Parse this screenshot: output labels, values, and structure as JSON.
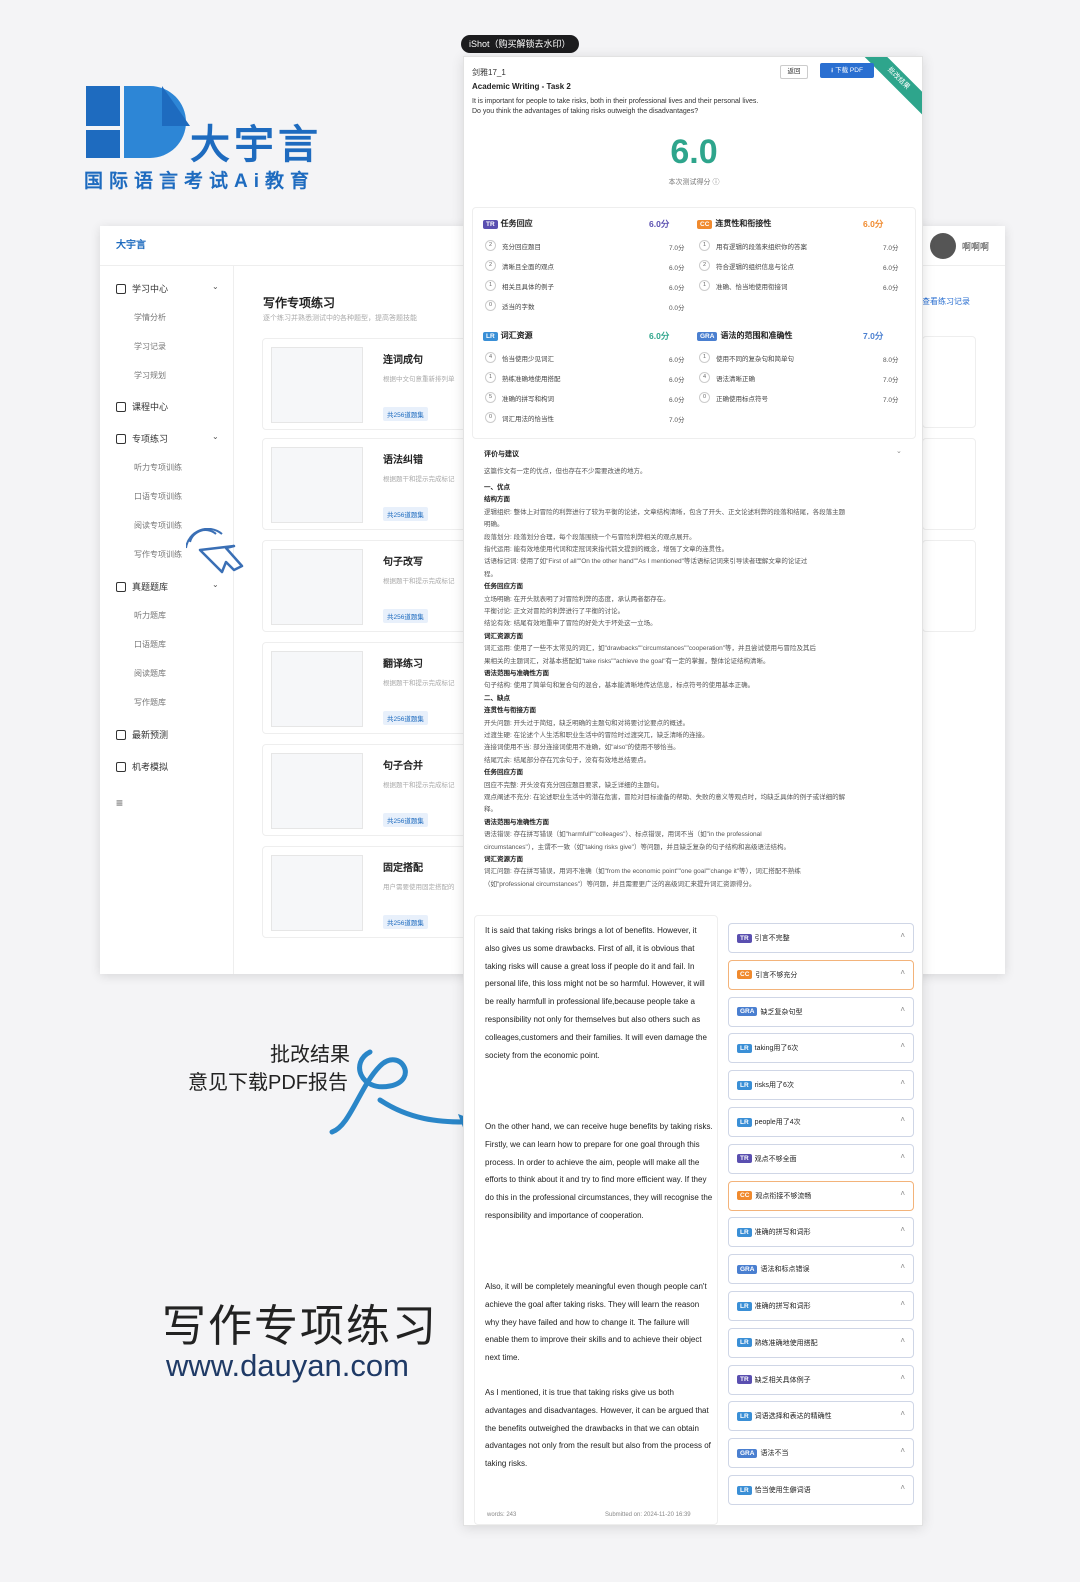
{
  "brand": {
    "name": "大宇言",
    "subtitle": "国际语言考试Ai教育",
    "app_logo": "大宇言"
  },
  "header": {
    "username": "啊啊啊"
  },
  "sidebar": {
    "items": [
      {
        "label": "学习中心",
        "chev": "⌄"
      },
      {
        "label": "课程中心"
      },
      {
        "label": "专项练习",
        "chev": "⌄"
      },
      {
        "label": "真题题库",
        "chev": "⌄"
      },
      {
        "label": "最新预测"
      },
      {
        "label": "机考模拟"
      }
    ],
    "sub_learning": [
      "学情分析",
      "学习记录",
      "学习规划"
    ],
    "sub_special": [
      "听力专项训练",
      "口语专项训练",
      "阅读专项训练",
      "写作专项训练"
    ],
    "sub_real": [
      "听力题库",
      "口语题库",
      "阅读题库",
      "写作题库"
    ],
    "collapse": "≡"
  },
  "main": {
    "title": "写作专项练习",
    "subtitle": "逐个练习并熟悉测试中的各种题型，提高答题技能",
    "view_record": "查看练习记录",
    "cards": [
      {
        "title": "连词成句",
        "desc": "根据中文句意重新排列单",
        "badge": "共256道题集"
      },
      {
        "title": "语法纠错",
        "desc": "根据题干和提示完成标记",
        "badge": "共256道题集"
      },
      {
        "title": "句子改写",
        "desc": "根据题干和提示完成标记",
        "badge": "共256道题集"
      },
      {
        "title": "翻译练习",
        "desc": "根据题干和提示完成标记",
        "badge": "共256道题集"
      },
      {
        "title": "句子合并",
        "desc": "根据题干和提示完成标记",
        "badge": "共256道题集"
      },
      {
        "title": "固定搭配",
        "desc": "用户需要使用固定搭配的",
        "badge": "共256道题集"
      }
    ]
  },
  "annotation": {
    "line1": "批改结果",
    "line2": "意见下载PDF报告",
    "big_title": "写作专项练习",
    "website": "www.dauyan.com"
  },
  "report": {
    "ishot": "iShot（购买解锁去水印）",
    "ribbon": "批改结果",
    "exam": "剑雅17_1",
    "task": "Academic Writing - Task 2",
    "question_1": "It is important for people to take risks, both in their professional lives and their personal lives.",
    "question_2": "Do you think the advantages of taking risks outweigh the disadvantages?",
    "back_btn": "返回",
    "pdf_btn": "⭳ 下载 PDF",
    "score": "6.0",
    "score_label": "本次测试得分 ⓘ",
    "criteria": [
      {
        "tag": "TR",
        "name": "任务回应",
        "score": "6.0分",
        "items": [
          [
            "2",
            "充分回应题目",
            "7.0分"
          ],
          [
            "2",
            "清晰且全面的观点",
            "6.0分"
          ],
          [
            "1",
            "相关且具体的例子",
            "6.0分"
          ],
          [
            "0",
            "适当的字数",
            "0.0分"
          ]
        ]
      },
      {
        "tag": "CC",
        "name": "连贯性和衔接性",
        "score": "6.0分",
        "items": [
          [
            "1",
            "用有逻辑的段落来组织你的答案",
            "7.0分"
          ],
          [
            "2",
            "符合逻辑的组织信息与论点",
            "6.0分"
          ],
          [
            "1",
            "准确、恰当地使用衔接词",
            "6.0分"
          ]
        ]
      },
      {
        "tag": "LR",
        "name": "词汇资源",
        "score": "6.0分",
        "items": [
          [
            "4",
            "恰当使用少见词汇",
            "6.0分"
          ],
          [
            "1",
            "熟练准确地使用搭配",
            "6.0分"
          ],
          [
            "5",
            "准确的拼写和构词",
            "6.0分"
          ],
          [
            "0",
            "词汇用法的恰当性",
            "7.0分"
          ]
        ]
      },
      {
        "tag": "GRA",
        "name": "语法的范围和准确性",
        "score": "7.0分",
        "items": [
          [
            "1",
            "使用不同的复杂句和简单句",
            "8.0分"
          ],
          [
            "4",
            "语法清晰正确",
            "7.0分"
          ],
          [
            "0",
            "正确使用标点符号",
            "7.0分"
          ]
        ]
      }
    ],
    "eval": {
      "title": "评价与建议",
      "intro": "这篇作文有一定的优点，但也存在不少需要改进的地方。",
      "lines": [
        {
          "t": "一、优点",
          "k": "b"
        },
        {
          "t": "结构方面",
          "k": "b"
        },
        {
          "t": "逻辑组织: 整体上对冒险的利弊进行了较为平衡的论述，文章结构清晰，包含了开头、正文论述利弊的段落和结尾，各段落主题",
          "k": "s"
        },
        {
          "t": "明确。",
          "k": "s"
        },
        {
          "t": "段落划分: 段落划分合理，每个段落围绕一个与冒险利弊相关的观点展开。",
          "k": "s"
        },
        {
          "t": "指代运用: 能有效地使用代词和定冠词来指代前文提到的概念，增强了文章的连贯性。",
          "k": "s"
        },
        {
          "t": "话语标记词: 使用了如\"First of all\"\"On the other hand\"\"As I mentioned\"等话语标记词来引导读者理解文章的论证过",
          "k": "s"
        },
        {
          "t": "程。",
          "k": "s"
        },
        {
          "t": "任务回应方面",
          "k": "b"
        },
        {
          "t": "立场明确: 在开头就表明了对冒险利弊的态度，承认两者都存在。",
          "k": "s"
        },
        {
          "t": "平衡讨论: 正文对冒险的利弊进行了平衡的讨论。",
          "k": "s"
        },
        {
          "t": "结论有效: 结尾有效地重申了冒险的好处大于坏处这一立场。",
          "k": "s"
        },
        {
          "t": "词汇资源方面",
          "k": "b"
        },
        {
          "t": "词汇运用: 使用了一些不太常见的词汇，如\"drawbacks\"\"circumstances\"\"cooperation\"等，并且尝试使用与冒险及其后",
          "k": "s"
        },
        {
          "t": "果相关的主题词汇，对基本搭配如\"take risks\"\"achieve the goal\"有一定的掌握，整体论证结构清晰。",
          "k": "s"
        },
        {
          "t": "语法范围与准确性方面",
          "k": "b"
        },
        {
          "t": "句子结构: 使用了简单句和复合句的混合，基本能清晰地传达信息，标点符号的使用基本正确。",
          "k": "s"
        },
        {
          "t": "二、缺点",
          "k": "b"
        },
        {
          "t": "连贯性与衔接方面",
          "k": "b"
        },
        {
          "t": "开头问题: 开头过于简短，缺乏明确的主题句和对将要讨论要点的概述。",
          "k": "s"
        },
        {
          "t": "过渡生硬: 在论述个人生活和职业生活中的冒险时过渡突兀，缺乏清晰的连接。",
          "k": "s"
        },
        {
          "t": "连接词使用不当: 部分连接词使用不准确，如\"also\"的使用不够恰当。",
          "k": "s"
        },
        {
          "t": "结尾冗余: 结尾部分存在冗余句子，没有有效地总结要点。",
          "k": "s"
        },
        {
          "t": "任务回应方面",
          "k": "b"
        },
        {
          "t": "回应不完整: 开头没有充分回应题目要求，缺乏详细的主题句。",
          "k": "s"
        },
        {
          "t": "观点阐述不充分: 在论述职业生活中的潜在危害，冒险对目标達备的帮助、失败的意义等观点时，均缺乏具体的例子或详细的解",
          "k": "s"
        },
        {
          "t": "释。",
          "k": "s"
        },
        {
          "t": "语法范围与准确性方面",
          "k": "b"
        },
        {
          "t": "语法错误: 存在拼写错误（如\"harmfull\"\"colleages\"）、标点错误，用词不当（如\"in the professional",
          "k": "s"
        },
        {
          "t": "circumstances\"），主谓不一致（如\"taking risks give\"）等问题，并且缺乏复杂的句子结构和高级语法结构。",
          "k": "s"
        },
        {
          "t": "词汇资源方面",
          "k": "b"
        },
        {
          "t": "词汇问题: 存在拼写错误，用词不准确（如\"from the economic point\"\"one goal\"\"change it\"等），词汇搭配不熟练",
          "k": "s"
        },
        {
          "t": "（如\"professional circumstances\"）等问题，并且需要更广泛的高级词汇来提升词汇资源得分。",
          "k": "s"
        }
      ]
    },
    "essay": {
      "p1": "It is said that taking risks brings a lot of benefits. However, it also gives us some drawbacks. First of all, it is obvious that taking risks will cause a great loss if people do it and fail. In personal life, this loss might not be so harmful. However, it will be really harmfull in professional life,because people take a responsibility not only for themselves but also others such as colleages,customers and their families. It will even damage the society from the economic point.",
      "p2": "On the other hand, we can receive huge benefits by taking risks. Firstly, we can learn how to prepare for one goal through this process. In order to achieve the aim, people will make all the efforts to think about it and try to find more efficient way. If they do this in the professional circumstances, they will recognise the responsibility and importance of cooperation.",
      "p3": "Also, it will be completely meaningful even though people can't achieve the goal after taking risks. They will learn the reason why they have failed and how to change it. The failure will enable them to improve their skills and to achieve their object next time.",
      "p4": "As I mentioned, it is true that taking risks give us both advantages and disadvantages. However, it can be argued that the benefits outweighed the drawbacks in that we can obtain advantages not only from the result but also from the process of taking risks.",
      "words": "words: 243",
      "submitted": "Submitted on: 2024-11-20 16:39"
    },
    "feedback": [
      {
        "tag": "TR",
        "text": "引言不完整"
      },
      {
        "tag": "CC",
        "text": "引言不够充分"
      },
      {
        "tag": "GRA",
        "text": "缺乏复杂句型"
      },
      {
        "tag": "LR",
        "text": "taking用了6次"
      },
      {
        "tag": "LR",
        "text": "risks用了6次"
      },
      {
        "tag": "LR",
        "text": "people用了4次"
      },
      {
        "tag": "TR",
        "text": "观点不够全面"
      },
      {
        "tag": "CC",
        "text": "观点衔接不够流畅"
      },
      {
        "tag": "LR",
        "text": "准确的拼写和词形"
      },
      {
        "tag": "GRA",
        "text": "语法和标点错误"
      },
      {
        "tag": "LR",
        "text": "准确的拼写和词形"
      },
      {
        "tag": "LR",
        "text": "熟练准确地使用搭配"
      },
      {
        "tag": "TR",
        "text": "缺乏相关具体例子"
      },
      {
        "tag": "LR",
        "text": "词语选择和表达的精确性"
      },
      {
        "tag": "GRA",
        "text": "语法不当"
      },
      {
        "tag": "LR",
        "text": "恰当使用生僻词语"
      }
    ]
  },
  "colors": {
    "brand": "#1e6bbf",
    "score": "#2ea58c",
    "tr": "#5a4fb0",
    "cc": "#f08a2e",
    "lr": "#3a8fd6",
    "gra": "#4a7fd0"
  }
}
